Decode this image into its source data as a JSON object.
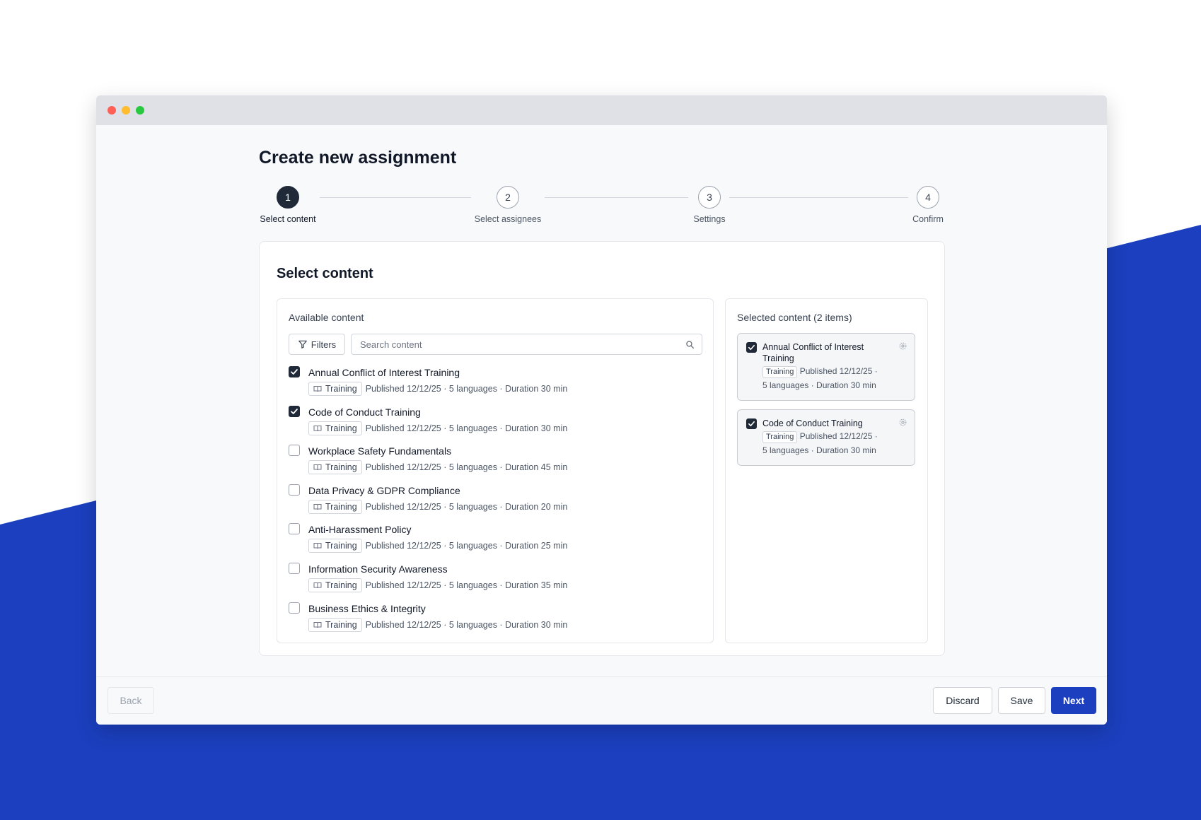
{
  "page": {
    "title": "Create new assignment"
  },
  "stepper": {
    "steps": [
      {
        "number": "1",
        "label": "Select content",
        "active": true
      },
      {
        "number": "2",
        "label": "Select assignees",
        "active": false
      },
      {
        "number": "3",
        "label": "Settings",
        "active": false
      },
      {
        "number": "4",
        "label": "Confirm",
        "active": false
      }
    ]
  },
  "card": {
    "title": "Select content"
  },
  "available": {
    "heading": "Available content",
    "filters_label": "Filters",
    "search_placeholder": "Search content",
    "items": [
      {
        "title": "Annual Conflict of Interest Training",
        "tag": "Training",
        "meta": "Published 12/12/25 · 5 languages · Duration 30 min",
        "checked": true
      },
      {
        "title": "Code of Conduct Training",
        "tag": "Training",
        "meta": "Published 12/12/25 · 5 languages · Duration 30 min",
        "checked": true
      },
      {
        "title": "Workplace Safety Fundamentals",
        "tag": "Training",
        "meta": "Published 12/12/25 · 5 languages · Duration 45 min",
        "checked": false
      },
      {
        "title": "Data Privacy & GDPR Compliance",
        "tag": "Training",
        "meta": "Published 12/12/25 · 5 languages · Duration 20 min",
        "checked": false
      },
      {
        "title": "Anti-Harassment Policy",
        "tag": "Training",
        "meta": "Published 12/12/25 · 5 languages · Duration 25 min",
        "checked": false
      },
      {
        "title": "Information Security Awareness",
        "tag": "Training",
        "meta": "Published 12/12/25 · 5 languages · Duration 35 min",
        "checked": false
      },
      {
        "title": "Business Ethics & Integrity",
        "tag": "Training",
        "meta": "Published 12/12/25 · 5 languages · Duration 30 min",
        "checked": false
      }
    ]
  },
  "selected": {
    "heading": "Selected content (2 items)",
    "items": [
      {
        "title": "Annual Conflict of Interest Training",
        "tag": "Training",
        "meta_line1": "Published 12/12/25 ·",
        "meta_line2": "5 languages · Duration 30 min"
      },
      {
        "title": "Code of Conduct Training",
        "tag": "Training",
        "meta_line1": "Published 12/12/25 ·",
        "meta_line2": "5 languages · Duration 30 min"
      }
    ]
  },
  "footer": {
    "back_label": "Back",
    "discard_label": "Discard",
    "save_label": "Save",
    "next_label": "Next"
  },
  "colors": {
    "brand_blue": "#1b3fbe",
    "dark": "#1f2937"
  },
  "icons": {
    "filters": "filter-funnel-icon",
    "search": "search-icon",
    "tag": "book-icon",
    "settings": "gear-icon",
    "check": "check-icon"
  }
}
